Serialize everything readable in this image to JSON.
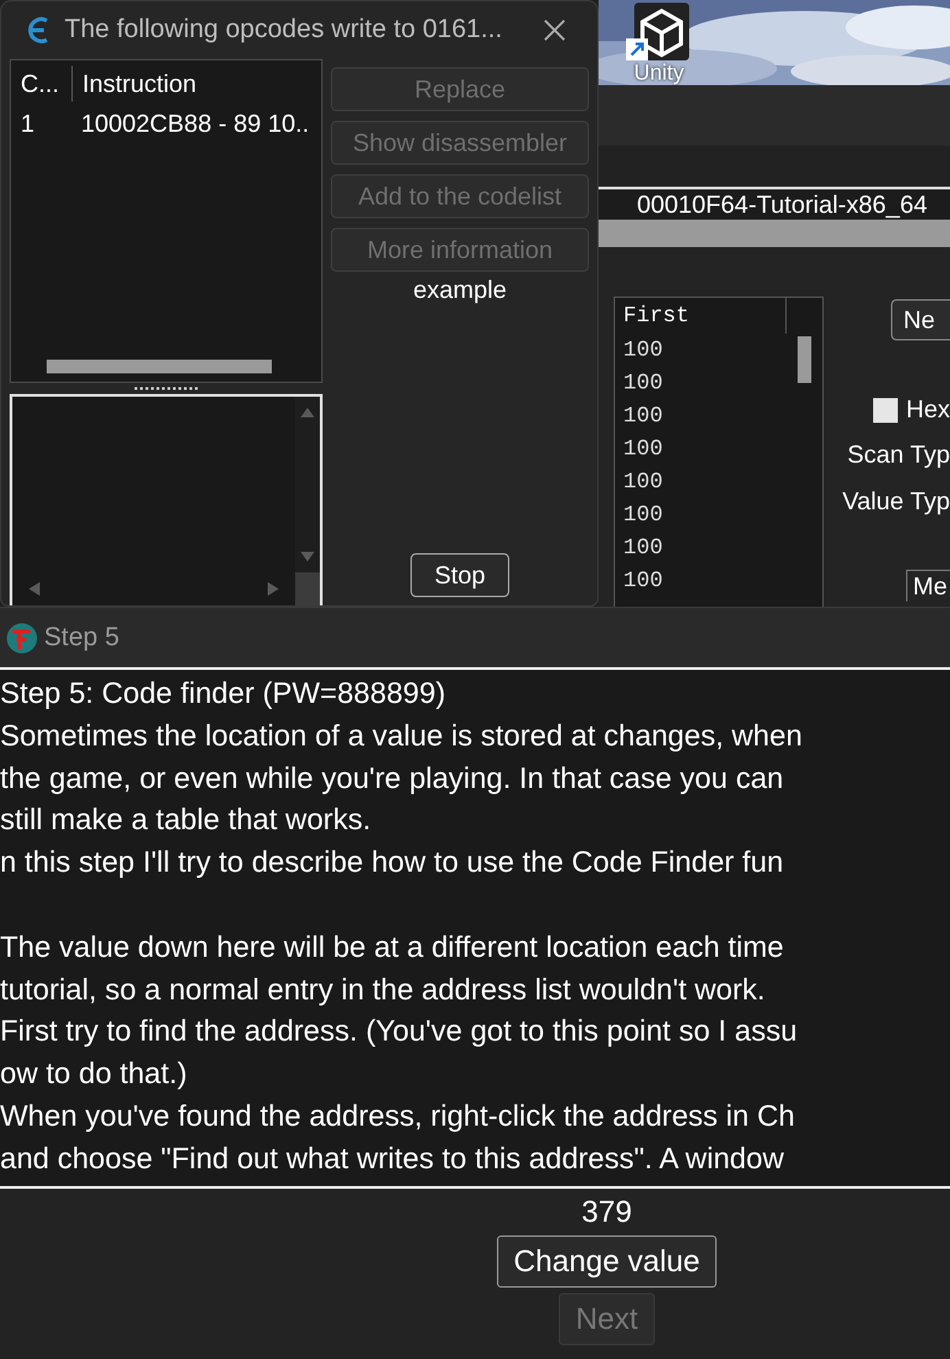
{
  "desktop": {
    "shortcut": {
      "label": "Unity"
    }
  },
  "main_window": {
    "process_bar": {
      "text": "00010F64-Tutorial-x86_64"
    },
    "results": {
      "columns": [
        "First"
      ],
      "rows": [
        "100",
        "100",
        "100",
        "100",
        "100",
        "100",
        "100",
        "100"
      ]
    },
    "new_button": {
      "label": "Ne"
    },
    "hex_checkbox": {
      "label": "Hex",
      "checked": false
    },
    "scan_type_label": "Scan Typ",
    "value_type_label": "Value Typ",
    "group_label": "Me"
  },
  "opcode_dialog": {
    "title": "The following opcodes write to 0161...",
    "columns": [
      "C...",
      "Instruction"
    ],
    "rows": [
      {
        "count": "1",
        "instruction": "10002CB88 - 89 10.."
      }
    ],
    "buttons": [
      {
        "label": "Replace",
        "disabled": true
      },
      {
        "label": "Show disassembler",
        "disabled": true
      },
      {
        "label": "Add to the codelist",
        "disabled": true
      },
      {
        "label": "More information",
        "disabled": true
      }
    ],
    "example_label": "example",
    "stop_button": {
      "label": "Stop",
      "disabled": false
    }
  },
  "tutorial": {
    "title": "Step 5",
    "paragraphs": [
      [
        "Step 5: Code finder (PW=888899)",
        "Sometimes the location of a value is stored at changes, when",
        "the game, or even while you're playing. In that case you can",
        "still make a table that works.",
        "n this step I'll try to describe how to use the Code Finder fun"
      ],
      [
        "The value down here will be at a different location each time",
        "tutorial, so a normal entry in the address list wouldn't work.",
        "First try to find the address. (You've got to this point so I assu",
        "ow to do that.)",
        "When you've found the address, right-click the address in Ch",
        "and choose \"Find out what writes to this address\". A window"
      ]
    ],
    "value": "379",
    "change_button": {
      "label": "Change value",
      "disabled": false
    },
    "next_button": {
      "label": "Next",
      "disabled": true
    }
  }
}
